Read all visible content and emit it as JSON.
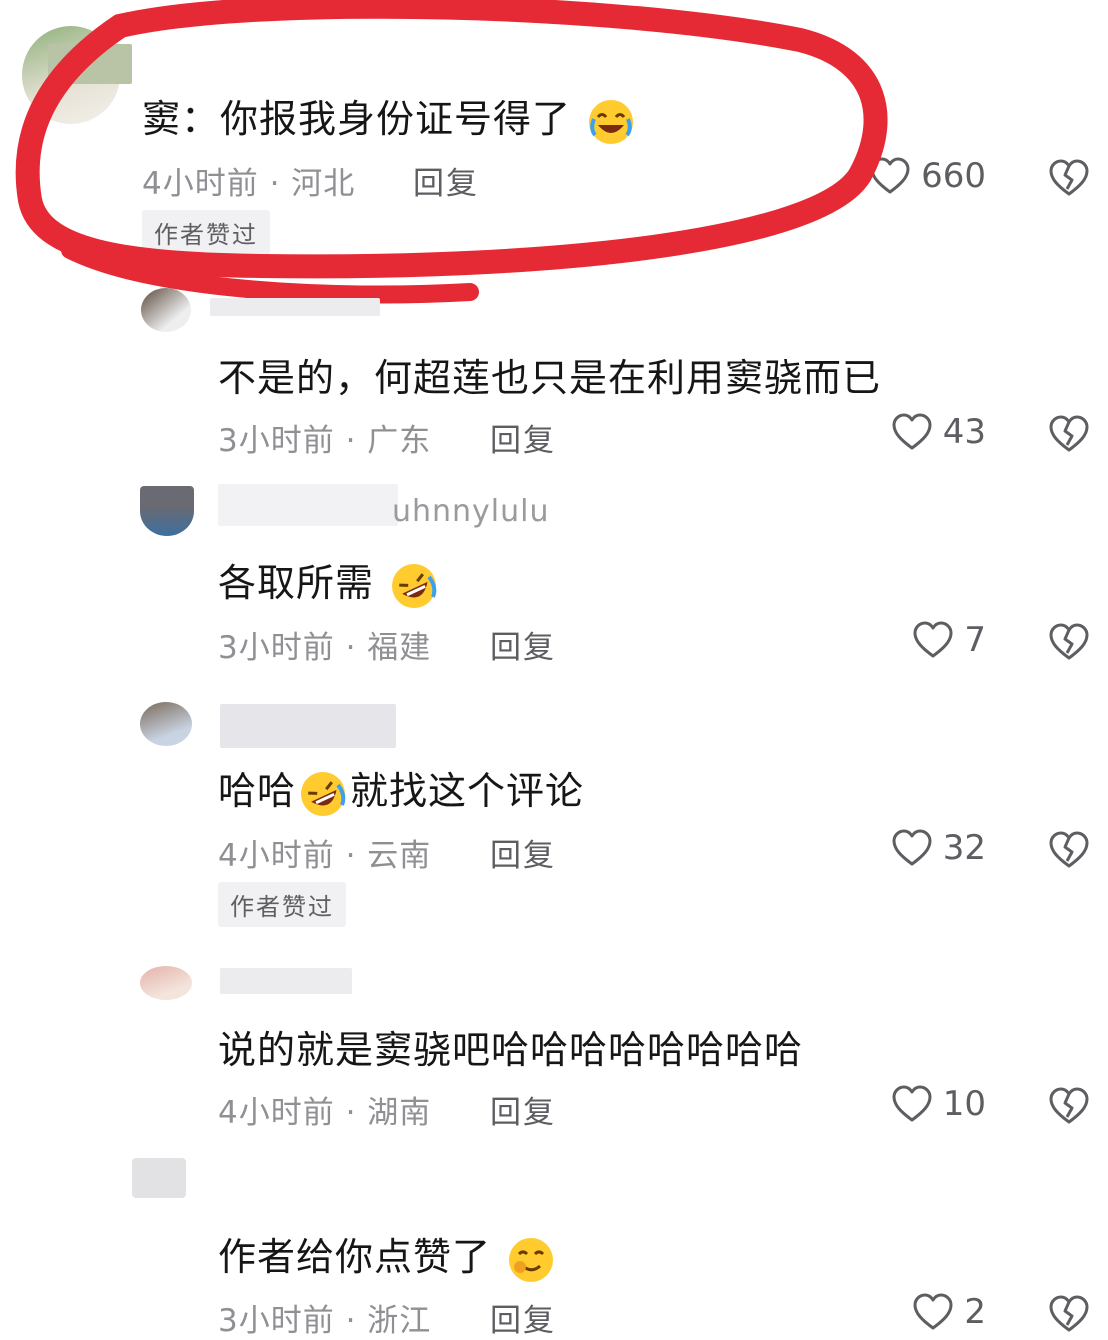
{
  "reply_label": "回复",
  "author_liked_label": "作者赞过",
  "accent": "#e52a36",
  "comments": [
    {
      "name": "窦",
      "name_suffix": "：",
      "text": "你报我身份证号得了",
      "emoji": "laugh-cry-emoji",
      "time": "4小时前 · 河北",
      "likes": "660",
      "author_liked": true
    },
    {
      "text": "不是的，何超莲也只是在利用窦骁而已",
      "time": "3小时前 · 广东",
      "likes": "43",
      "author_liked": false
    },
    {
      "username_tail": "uhnnylulu",
      "text": "各取所需",
      "emoji": "rofl-emoji",
      "time": "3小时前 · 福建",
      "likes": "7",
      "author_liked": false
    },
    {
      "text_a": "哈哈",
      "text_b": "就找这个评论",
      "emoji": "rofl-emoji",
      "time": "4小时前 · 云南",
      "likes": "32",
      "author_liked": true
    },
    {
      "text": "说的就是窦骁吧哈哈哈哈哈哈哈哈",
      "time": "4小时前 · 湖南",
      "likes": "10",
      "author_liked": false
    },
    {
      "text": "作者给你点赞了",
      "emoji": "wink-emoji",
      "time": "3小时前 · 浙江",
      "likes": "2",
      "author_liked": false
    }
  ]
}
